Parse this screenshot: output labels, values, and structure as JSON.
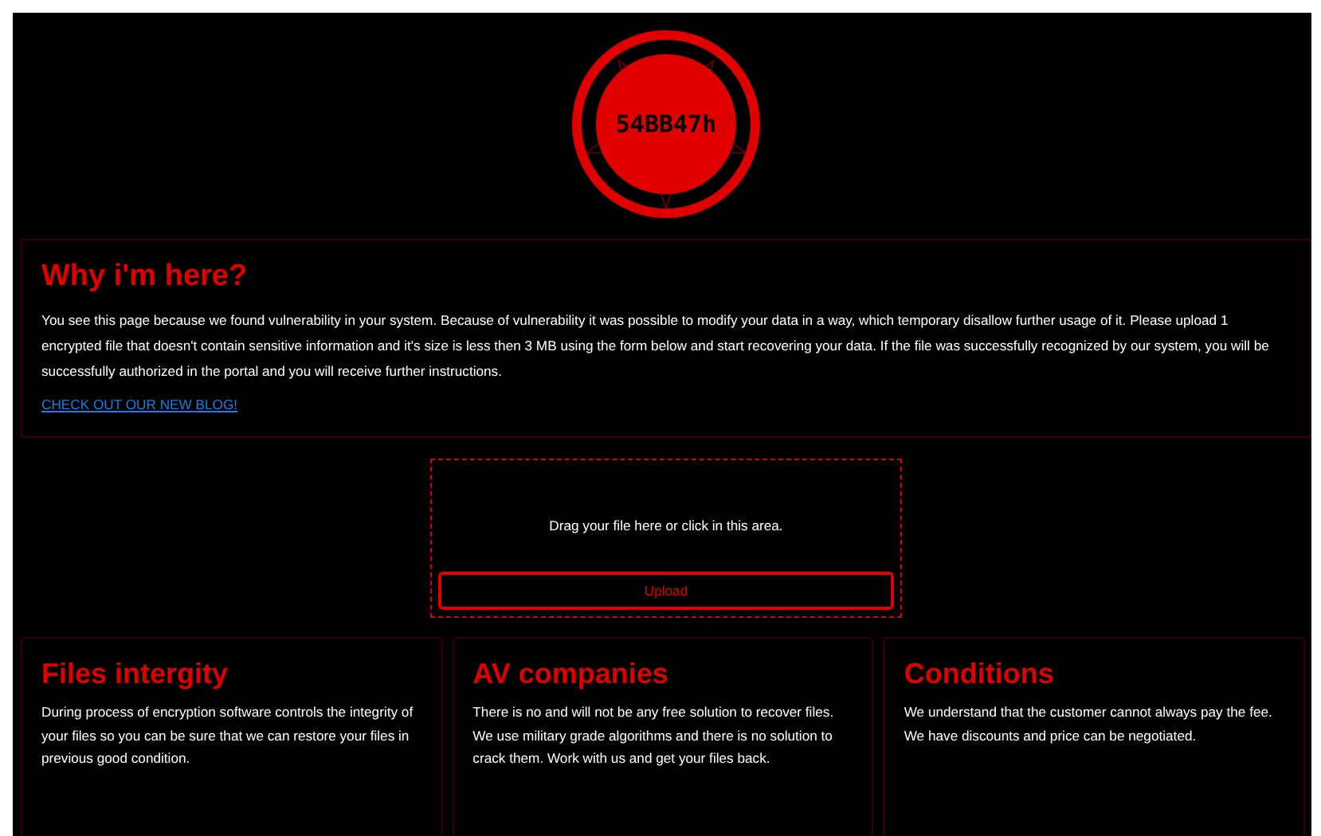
{
  "logo": {
    "text": "54BB47h"
  },
  "intro": {
    "title": "Why i'm here?",
    "text": "You see this page because we found vulnerability in your system. Because of vulnerability it was possible to modify your data in a way, which temporary disallow further usage of it. Please upload 1 encrypted file that doesn't contain sensitive information and it's size is less then 3 MB using the form below and start recovering your data. If the file was successfully recognized by our system, you will be successfully authorized in the portal and you will receive further instructions.",
    "link": "CHECK OUT OUR NEW BLOG!"
  },
  "upload": {
    "hint": "Drag your file here or click in this area.",
    "button": "Upload"
  },
  "cards": [
    {
      "title": "Files intergity",
      "text": "During process of encryption software controls the integrity of your files so you can be sure that we can restore your files in previous good condition."
    },
    {
      "title": "AV companies",
      "text": "There is no and will not be any free solution to recover files. We use military grade algorithms and there is no solution to crack them. Work with us and get your files back."
    },
    {
      "title": "Conditions",
      "text": "We understand that the customer cannot always pay the fee. We have discounts and price can be negotiated."
    }
  ]
}
